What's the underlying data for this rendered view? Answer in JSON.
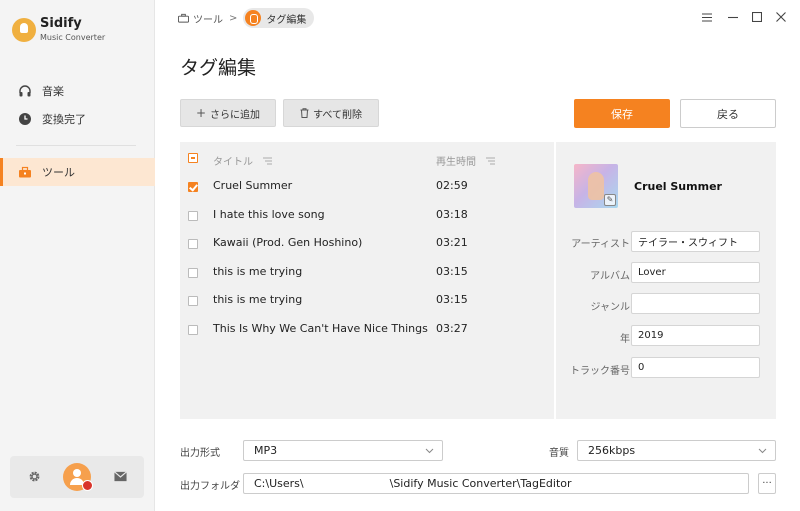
{
  "app": {
    "name": "Sidify",
    "subtitle": "Music Converter"
  },
  "sidebar": {
    "items": [
      {
        "label": "音楽",
        "icon": "headphones-icon"
      },
      {
        "label": "変換完了",
        "icon": "clock-icon"
      },
      {
        "label": "ツール",
        "icon": "toolbox-icon",
        "active": true
      }
    ]
  },
  "breadcrumb": {
    "root": "ツール",
    "separator": ">",
    "current": "タグ編集"
  },
  "page": {
    "title": "タグ編集"
  },
  "toolbar": {
    "add_label": "さらに追加",
    "delete_all_label": "すべて削除",
    "save_label": "保存",
    "back_label": "戻る"
  },
  "table": {
    "headers": {
      "title": "タイトル",
      "duration": "再生時間"
    },
    "rows": [
      {
        "title": "Cruel Summer",
        "duration": "02:59",
        "checked": true
      },
      {
        "title": "I hate this love song",
        "duration": "03:18",
        "checked": false
      },
      {
        "title": "Kawaii (Prod. Gen Hoshino)",
        "duration": "03:21",
        "checked": false
      },
      {
        "title": "this is me trying",
        "duration": "03:15",
        "checked": false
      },
      {
        "title": "this is me trying",
        "duration": "03:15",
        "checked": false
      },
      {
        "title": "This Is Why We Can't Have Nice Things",
        "duration": "03:27",
        "checked": false
      }
    ]
  },
  "details": {
    "track_title": "Cruel Summer",
    "fields": [
      {
        "label": "アーティスト",
        "value": "テイラー・スウィフト"
      },
      {
        "label": "アルバム",
        "value": "Lover"
      },
      {
        "label": "ジャンル",
        "value": ""
      },
      {
        "label": "年",
        "value": "2019"
      },
      {
        "label": "トラック番号",
        "value": "0"
      }
    ]
  },
  "output": {
    "format_label": "出力形式",
    "format_value": "MP3",
    "quality_label": "音質",
    "quality_value": "256kbps",
    "folder_label": "出力フォルダ",
    "folder_path_start": "C:\\Users\\",
    "folder_path_end": "\\Sidify Music Converter\\TagEditor",
    "browse_label": "···"
  },
  "colors": {
    "accent": "#f58220",
    "active_bg": "#fde7d2",
    "panel_bg": "#f1f1f1"
  }
}
